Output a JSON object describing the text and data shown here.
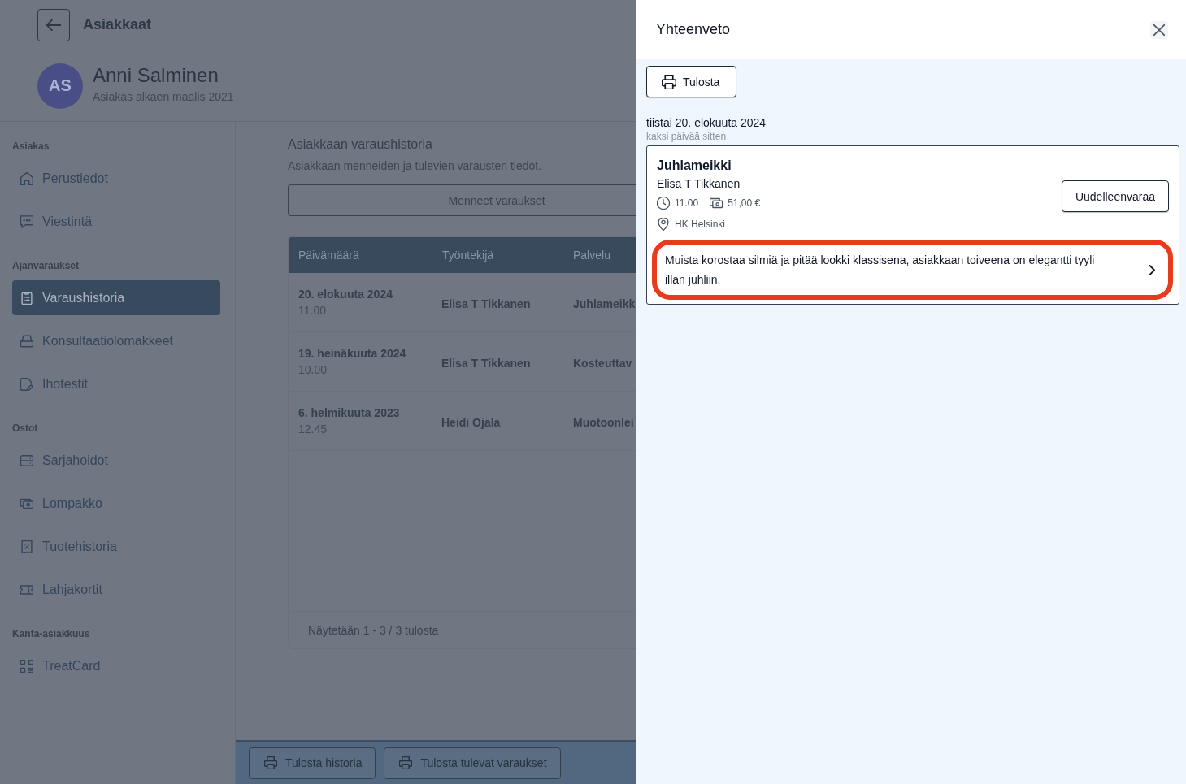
{
  "header": {
    "title": "Asiakkaat"
  },
  "customer": {
    "initials": "AS",
    "name": "Anni Salminen",
    "since": "Asiakas alkaen maalis 2021"
  },
  "sidebar": {
    "sections": [
      {
        "label": "Asiakas",
        "items": [
          {
            "kind": "home",
            "label": "Perustiedot",
            "selected": false
          },
          {
            "kind": "chat",
            "label": "Viestintä",
            "selected": false
          }
        ]
      },
      {
        "label": "Ajanvaraukset",
        "items": [
          {
            "kind": "clipboard",
            "label": "Varaushistoria",
            "selected": true
          },
          {
            "kind": "tray",
            "label": "Konsultaatiolomakkeet",
            "selected": false
          },
          {
            "kind": "document",
            "label": "Ihotestit",
            "selected": false
          }
        ]
      },
      {
        "label": "Ostot",
        "items": [
          {
            "kind": "drawer",
            "label": "Sarjahoidot",
            "selected": false
          },
          {
            "kind": "banknotes",
            "label": "Lompakko",
            "selected": false
          },
          {
            "kind": "receipt",
            "label": "Tuotehistoria",
            "selected": false
          },
          {
            "kind": "ticket",
            "label": "Lahjakortit",
            "selected": false
          }
        ]
      },
      {
        "label": "Kanta-asiakkuus",
        "items": [
          {
            "kind": "qr",
            "label": "TreatCard",
            "selected": false
          }
        ]
      }
    ]
  },
  "main": {
    "title": "Asiakkaan varaushistoria",
    "subtitle": "Asiakkaan menneiden ja tulevien varausten tiedot.",
    "toggle_button": "Menneet varaukset",
    "table": {
      "columns": [
        "Päivämäärä",
        "Työntekijä",
        "Palvelu"
      ],
      "rows": [
        {
          "date": "20. elokuuta 2024",
          "time": "11.00",
          "employee": "Elisa T Tikkanen",
          "service": "Juhlameikk"
        },
        {
          "date": "19. heinäkuuta 2024",
          "time": "10.00",
          "employee": "Elisa T Tikkanen",
          "service": "Kosteuttav"
        },
        {
          "date": "6. helmikuuta 2023",
          "time": "12.45",
          "employee": "Heidi Ojala",
          "service": "Muotoonlei"
        }
      ],
      "footer": "Näytetään 1 - 3 / 3 tulosta"
    },
    "bottom_bar": {
      "buttons": [
        "Tulosta historia",
        "Tulosta tulevat varaukset"
      ]
    }
  },
  "panel": {
    "title": "Yhteenveto",
    "print_button": "Tulosta",
    "date": "tiistai 20. elokuuta 2024",
    "relative_date": "kaksi päivää sitten",
    "booking": {
      "service": "Juhlameikki",
      "employee": "Elisa T Tikkanen",
      "time": "11.00",
      "price": "51,00 €",
      "location": "HK Helsinki",
      "rebook_button": "Uudelleenvaraa",
      "note": {
        "text": "Muista korostaa silmiä ja pitää lookki klassisena, asiakkaan toiveena on elegantti tyyli illan juhliin.",
        "highlighted": true
      }
    }
  }
}
